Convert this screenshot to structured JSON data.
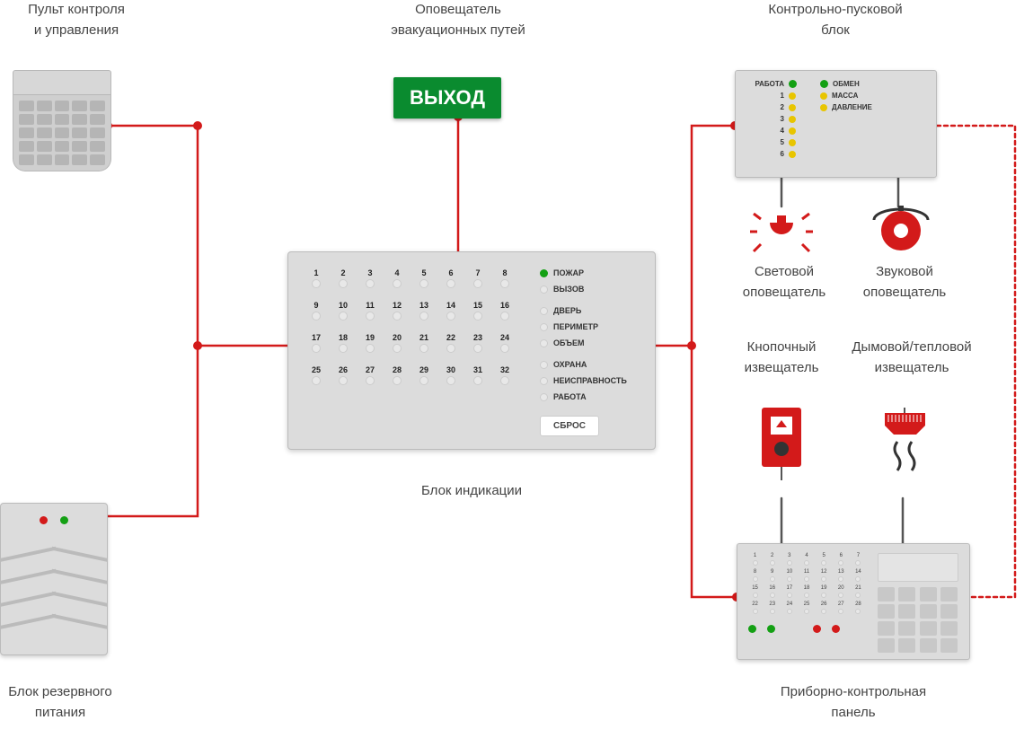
{
  "labels": {
    "control_panel": "Пульт контроля\nи управления",
    "evac_notifier": "Оповещатель\nэвакуационных путей",
    "clb": "Контрольно-пусковой\nблок",
    "indicator": "Блок индикации",
    "backup_power": "Блок резервного\nпитания",
    "light_notifier": "Световой\nоповещатель",
    "sound_notifier": "Звуковой\nоповещатель",
    "call_point": "Кнопочный\nизвещатель",
    "detector": "Дымовой/тепловой\nизвещатель",
    "pkp": "Приборно-контрольная\nпанель"
  },
  "exit_sign": "ВЫХОД",
  "indicator_block": {
    "zones": [
      1,
      2,
      3,
      4,
      5,
      6,
      7,
      8,
      9,
      10,
      11,
      12,
      13,
      14,
      15,
      16,
      17,
      18,
      19,
      20,
      21,
      22,
      23,
      24,
      25,
      26,
      27,
      28,
      29,
      30,
      31,
      32
    ],
    "statuses": [
      "ПОЖАР",
      "ВЫЗОВ",
      "ДВЕРЬ",
      "ПЕРИМЕТР",
      "ОБЪЕМ",
      "ОХРАНА",
      "НЕИСПРАВНОСТЬ",
      "РАБОТА"
    ],
    "active_status_index": 0,
    "reset_button": "СБРОС"
  },
  "clb": {
    "left_labels": [
      "РАБОТА",
      "1",
      "2",
      "3",
      "4",
      "5",
      "6"
    ],
    "right_labels": [
      "ОБМЕН",
      "МАССА",
      "ДАВЛЕНИЕ"
    ]
  },
  "pkp": {
    "numbers": [
      1,
      2,
      3,
      4,
      5,
      6,
      7,
      8,
      9,
      10,
      11,
      12,
      13,
      14,
      15,
      16,
      17,
      18,
      19,
      20,
      21,
      22,
      23,
      24,
      25,
      26,
      27,
      28
    ]
  },
  "colors": {
    "wire": "#d31a1a",
    "green": "#14a014",
    "yellow": "#e8c500",
    "device_bg": "#dcdcdc"
  }
}
